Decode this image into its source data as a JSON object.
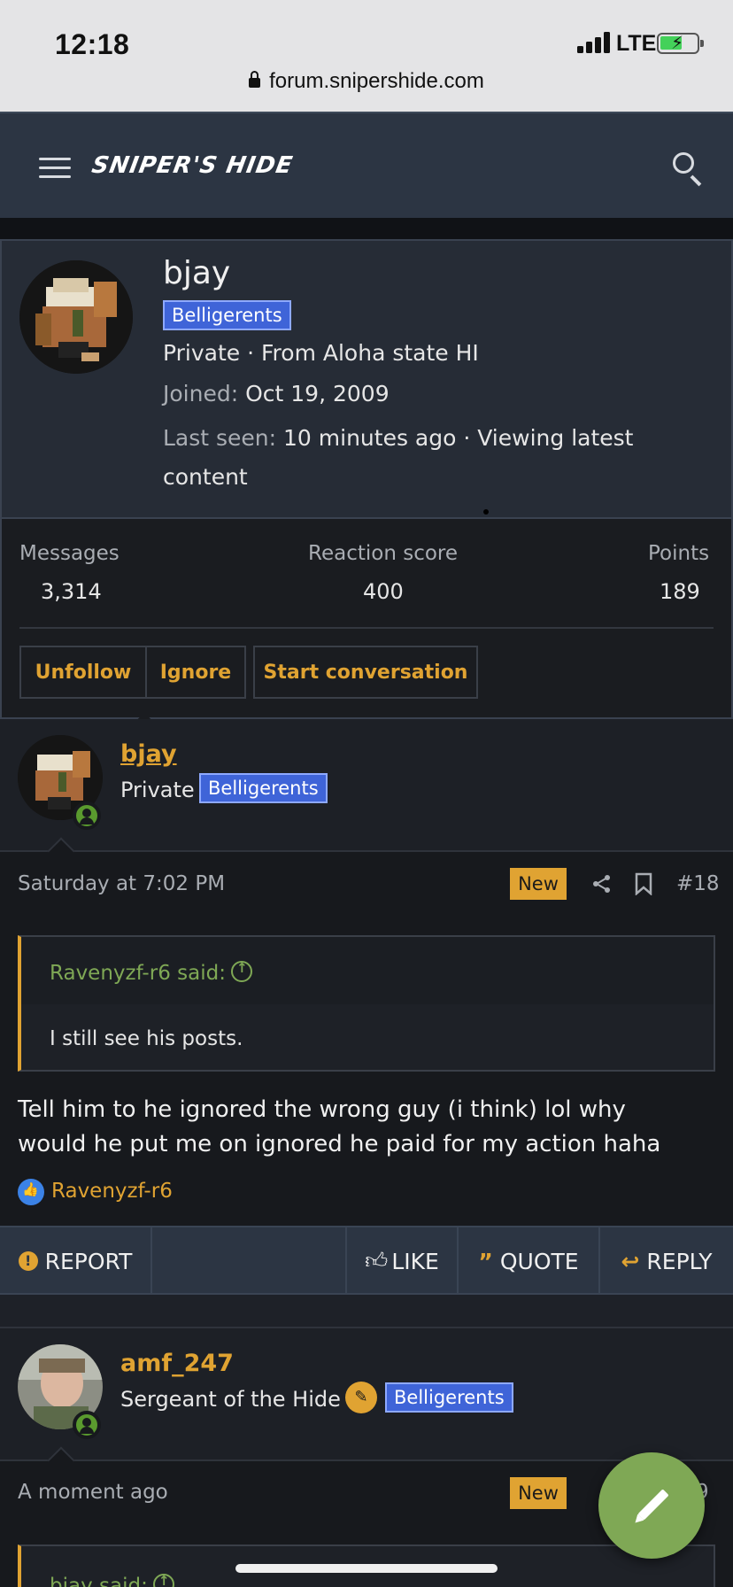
{
  "status_bar": {
    "time": "12:18",
    "network": "LTE"
  },
  "browser": {
    "url": "forum.snipershide.com"
  },
  "header": {
    "logo": "SNIPER'S HIDE"
  },
  "profile_popup": {
    "username": "bjay",
    "banner": "Belligerents",
    "title_location": "Private · From Aloha state HI",
    "joined_label": "Joined:",
    "joined_value": "Oct 19, 2009",
    "last_seen_label": "Last seen:",
    "last_seen_value_line1": "10 minutes ago · Viewing latest",
    "last_seen_value_line2": "content",
    "stats": {
      "messages_label": "Messages",
      "messages_value": "3,314",
      "reaction_label": "Reaction score",
      "reaction_value": "400",
      "points_label": "Points",
      "points_value": "189"
    },
    "buttons": {
      "unfollow": "Unfollow",
      "ignore": "Ignore",
      "start_conversation": "Start conversation"
    }
  },
  "post_18": {
    "username": "bjay",
    "user_title": "Private",
    "banner": "Belligerents",
    "date": "Saturday at 7:02 PM",
    "new_badge": "New",
    "post_number": "#18",
    "quote_author": "Ravenyzf-r6 said:",
    "quote_text": "I still see his posts.",
    "body_line1": "Tell him to he ignored the wrong guy (i think) lol why",
    "body_line2": "would he put me on ignored he paid for my action haha",
    "likers": "Ravenyzf-r6",
    "actions": {
      "report": "REPORT",
      "like": "LIKE",
      "quote": "QUOTE",
      "reply": "REPLY"
    }
  },
  "post_19": {
    "username": "amf_247",
    "user_title": "Sergeant of the Hide",
    "banner": "Belligerents",
    "date": "A moment ago",
    "new_badge": "New",
    "post_number": "9",
    "quote_author": "bjay said:"
  },
  "colors": {
    "accent": "#e0a332",
    "banner": "#3f64d8",
    "header": "#2c3543",
    "online": "#5a9a2e",
    "fab": "#7fa855"
  }
}
